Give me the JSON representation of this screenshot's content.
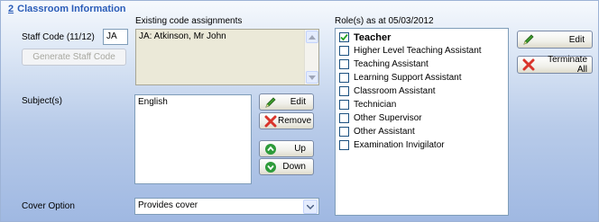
{
  "section": {
    "number": "2",
    "title": "Classroom Information"
  },
  "staff_code": {
    "label": "Staff Code (11/12)",
    "value": "JA"
  },
  "generate_button": {
    "label": "Generate Staff Code"
  },
  "existing_codes": {
    "label": "Existing code assignments",
    "value": "JA: Atkinson, Mr John"
  },
  "subjects": {
    "label": "Subject(s)",
    "items": [
      "English"
    ]
  },
  "subject_buttons": {
    "edit": "Edit",
    "remove": "Remove",
    "up": "Up",
    "down": "Down"
  },
  "cover_option": {
    "label": "Cover Option",
    "selected": "Provides cover"
  },
  "roles": {
    "label": "Role(s) as at 05/03/2012",
    "items": [
      {
        "label": "Teacher",
        "checked": true
      },
      {
        "label": "Higher Level Teaching Assistant",
        "checked": false
      },
      {
        "label": "Teaching Assistant",
        "checked": false
      },
      {
        "label": "Learning Support Assistant",
        "checked": false
      },
      {
        "label": "Classroom Assistant",
        "checked": false
      },
      {
        "label": "Technician",
        "checked": false
      },
      {
        "label": "Other Supervisor",
        "checked": false
      },
      {
        "label": "Other Assistant",
        "checked": false
      },
      {
        "label": "Examination Invigilator",
        "checked": false
      }
    ]
  },
  "role_buttons": {
    "edit": "Edit",
    "terminate_all": "Terminate All"
  },
  "colors": {
    "section_title": "#2a5cb8",
    "pencil_green": "#3c9a2a",
    "remove_red": "#d9342b",
    "arrow_green": "#2e9b3a"
  },
  "icons": {
    "edit": "pencil-icon",
    "remove": "red-x-icon",
    "up": "green-up-arrow-icon",
    "down": "green-down-arrow-icon",
    "checkbox": "check-icon"
  }
}
